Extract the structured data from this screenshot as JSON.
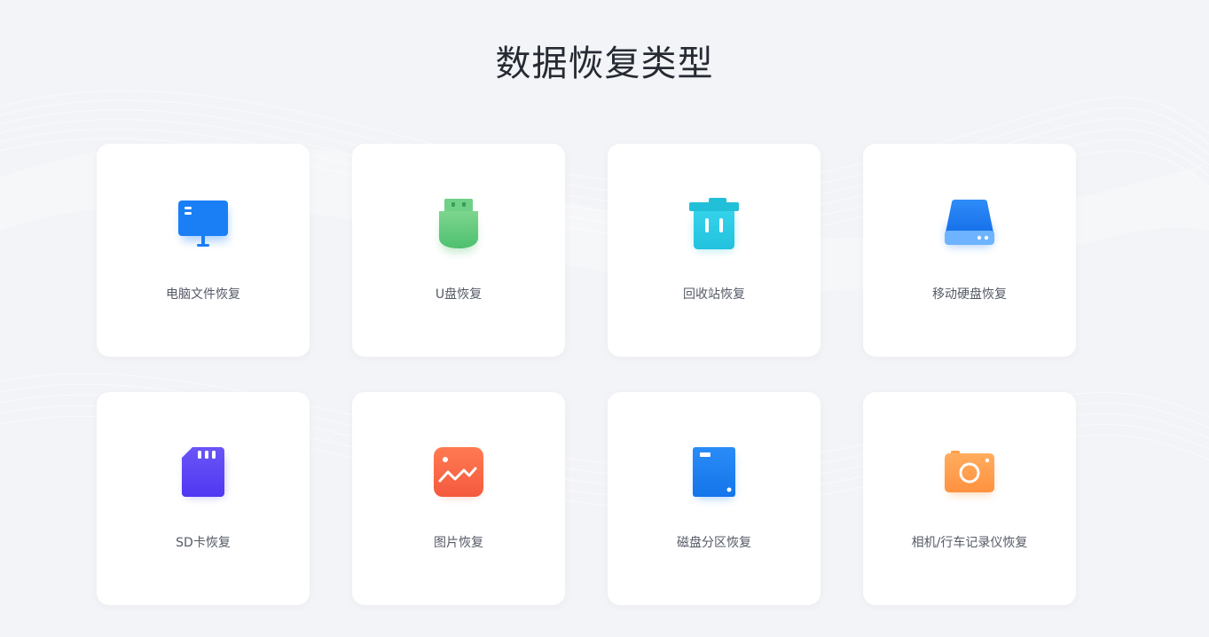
{
  "page": {
    "title": "数据恢复类型"
  },
  "cards": [
    {
      "label": "电脑文件恢复",
      "icon": "monitor-icon",
      "color": "#1a7ff5"
    },
    {
      "label": "U盘恢复",
      "icon": "usb-drive-icon",
      "color": "#5ec77a"
    },
    {
      "label": "回收站恢复",
      "icon": "trash-bin-icon",
      "color": "#2ec9e0"
    },
    {
      "label": "移动硬盘恢复",
      "icon": "external-hard-drive-icon",
      "color": "#2a86f5"
    },
    {
      "label": "SD卡恢复",
      "icon": "sd-card-icon",
      "color": "#5a47f5"
    },
    {
      "label": "图片恢复",
      "icon": "image-icon",
      "color": "#f86a48"
    },
    {
      "label": "磁盘分区恢复",
      "icon": "disk-partition-icon",
      "color": "#1f82f2"
    },
    {
      "label": "相机/行车记录仪恢复",
      "icon": "camera-icon",
      "color": "#ff9b45"
    }
  ]
}
